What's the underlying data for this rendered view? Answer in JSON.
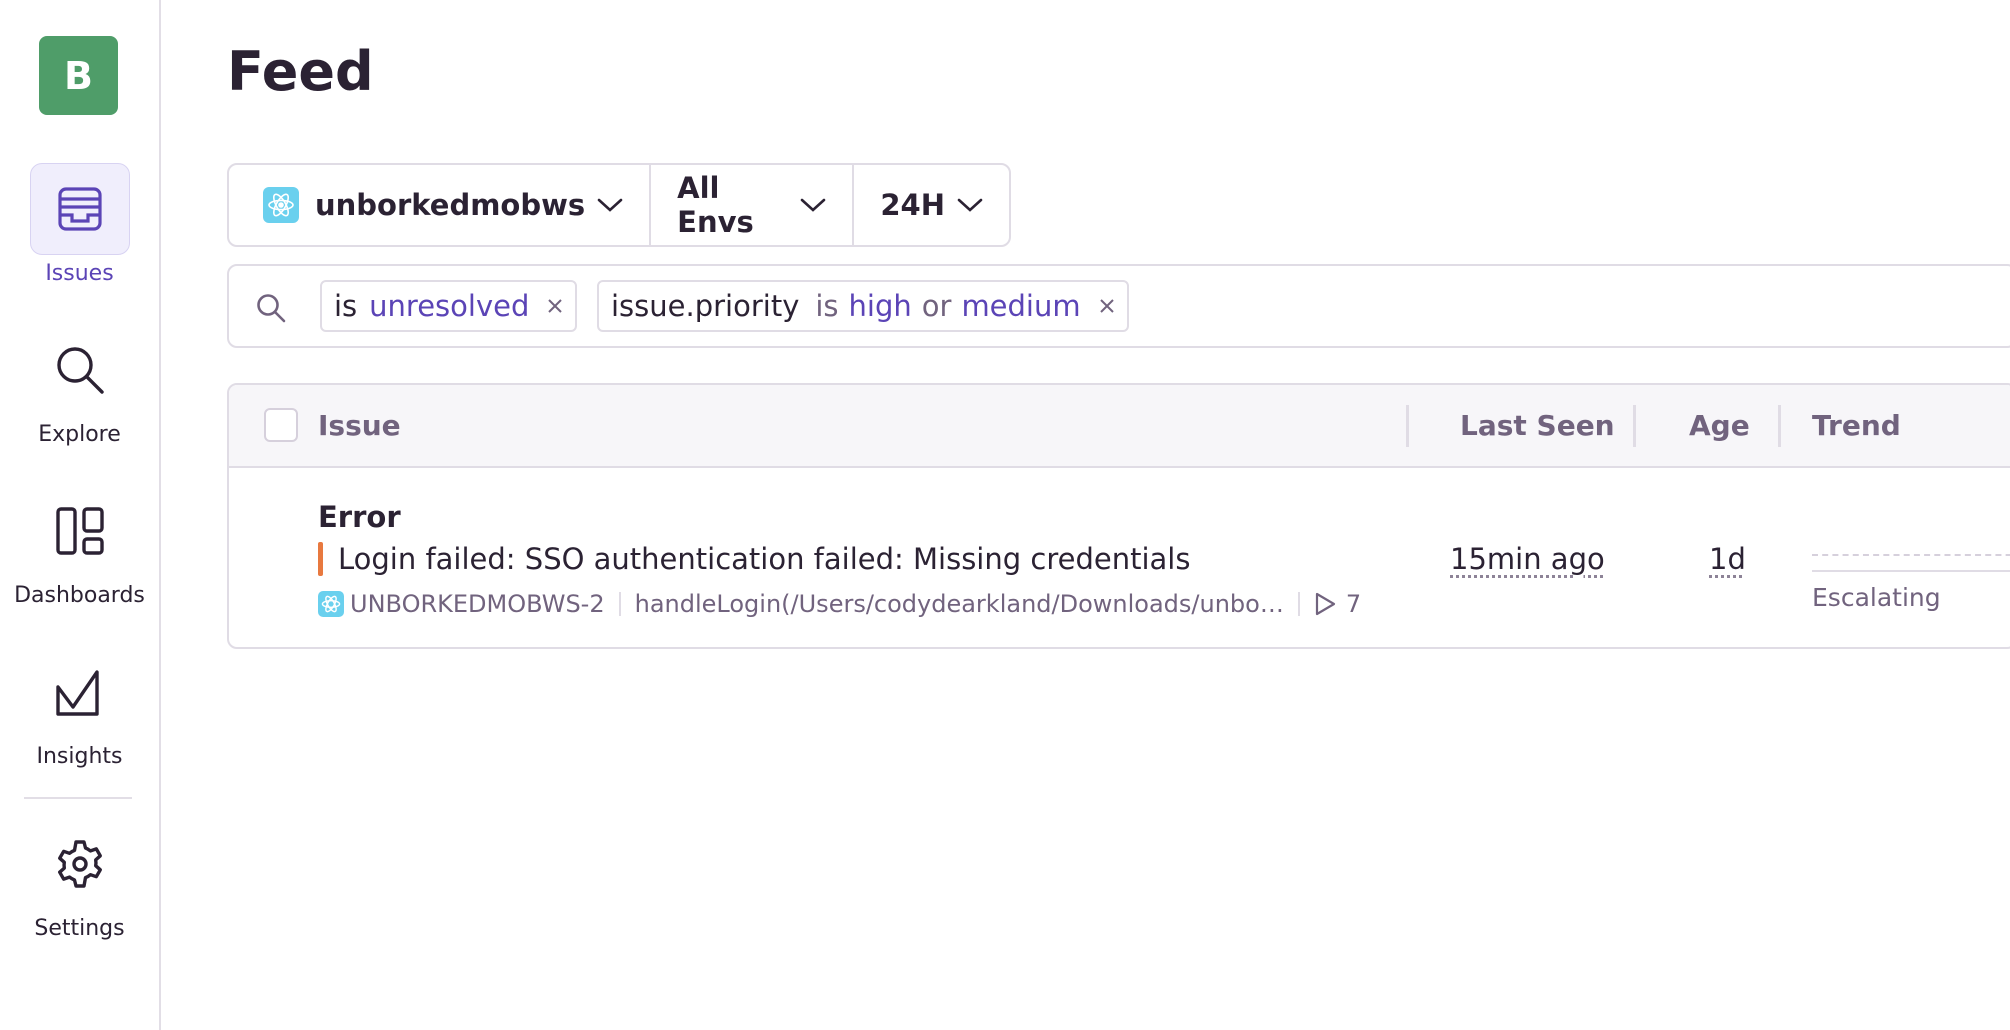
{
  "sidebar": {
    "org_initial": "B",
    "items": [
      {
        "id": "issues",
        "label": "Issues",
        "active": true
      },
      {
        "id": "explore",
        "label": "Explore",
        "active": false
      },
      {
        "id": "dashboards",
        "label": "Dashboards",
        "active": false
      },
      {
        "id": "insights",
        "label": "Insights",
        "active": false
      },
      {
        "id": "settings",
        "label": "Settings",
        "active": false
      }
    ]
  },
  "page": {
    "title": "Feed"
  },
  "filters": {
    "project": "unborkedmobws",
    "environment": "All Envs",
    "period": "24H"
  },
  "search": {
    "tokens": [
      {
        "key": "is",
        "value": "unresolved"
      },
      {
        "key": "issue.priority",
        "op": "is",
        "value1": "high",
        "or": "or",
        "value2": "medium"
      }
    ]
  },
  "table": {
    "headers": {
      "issue": "Issue",
      "last_seen": "Last Seen",
      "age": "Age",
      "trend": "Trend"
    },
    "rows": [
      {
        "type": "Error",
        "message": "Login failed: SSO authentication failed: Missing credentials",
        "short_id": "UNBORKEDMOBWS-2",
        "culprit": "handleLogin(/Users/codydearkland/Downloads/unbo…",
        "events": "7",
        "last_seen": "15min ago",
        "age": "1d",
        "trend_status": "Escalating"
      }
    ]
  },
  "colors": {
    "accent": "#5b44b6",
    "org": "#4f9d69",
    "priority_medium": "#e8793f",
    "react": "#6ad0ee"
  }
}
